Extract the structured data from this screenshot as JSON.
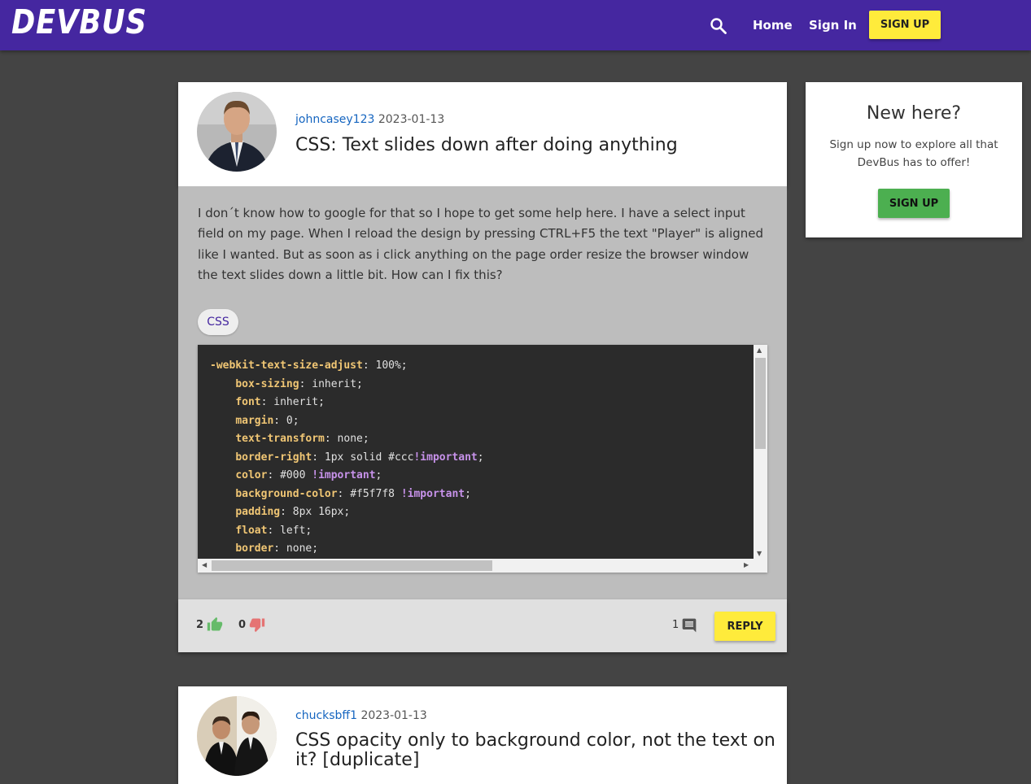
{
  "nav": {
    "logo": "DEVBUS",
    "home": "Home",
    "sign_in": "Sign In",
    "sign_up": "SIGN UP",
    "search_icon": "search-icon"
  },
  "post": {
    "author": "johncasey123",
    "date": "2023-01-13",
    "title": "CSS: Text slides down after doing anything",
    "body": "I don´t know how to google for that so I hope to get some help here. I have a select input field on my page. When I reload the design by pressing CTRL+F5 the text \"Player\" is aligned like I wanted. But as soon as i click anything on the page order resize the browser window the text slides down a little bit. How can I fix this?",
    "tag": "CSS",
    "code": [
      {
        "indent": "",
        "prop": "-webkit-text-size-adjust",
        "value": ": 100%;",
        "imp": "",
        "end": ""
      },
      {
        "indent": "    ",
        "prop": "box-sizing",
        "value": ": inherit;",
        "imp": "",
        "end": ""
      },
      {
        "indent": "    ",
        "prop": "font",
        "value": ": inherit;",
        "imp": "",
        "end": ""
      },
      {
        "indent": "    ",
        "prop": "margin",
        "value": ": 0;",
        "imp": "",
        "end": ""
      },
      {
        "indent": "    ",
        "prop": "text-transform",
        "value": ": none;",
        "imp": "",
        "end": ""
      },
      {
        "indent": "    ",
        "prop": "border-right",
        "value": ": 1px solid #ccc",
        "imp": "!important",
        "end": ";"
      },
      {
        "indent": "    ",
        "prop": "color",
        "value": ": #000 ",
        "imp": "!important",
        "end": ";"
      },
      {
        "indent": "    ",
        "prop": "background-color",
        "value": ": #f5f7f8 ",
        "imp": "!important",
        "end": ";"
      },
      {
        "indent": "    ",
        "prop": "padding",
        "value": ": 8px 16px;",
        "imp": "",
        "end": ""
      },
      {
        "indent": "    ",
        "prop": "float",
        "value": ": left;",
        "imp": "",
        "end": ""
      },
      {
        "indent": "    ",
        "prop": "border",
        "value": ": none;",
        "imp": "",
        "end": ""
      }
    ],
    "upvotes": "2",
    "downvotes": "0",
    "comments": "1",
    "reply": "REPLY"
  },
  "sidebar": {
    "title": "New here?",
    "text": "Sign up now to explore all that DevBus has to offer!",
    "button": "SIGN UP"
  },
  "post2": {
    "author": "chucksbff1",
    "date": "2023-01-13",
    "title": "CSS opacity only to background color, not the text on it? [duplicate]"
  },
  "colors": {
    "navbar": "#4527a0",
    "accent_yellow": "#ffeb3b",
    "sidebar_button": "#4caf50",
    "upvote": "#66bb6a",
    "downvote": "#e57373",
    "link": "#1565c0"
  }
}
